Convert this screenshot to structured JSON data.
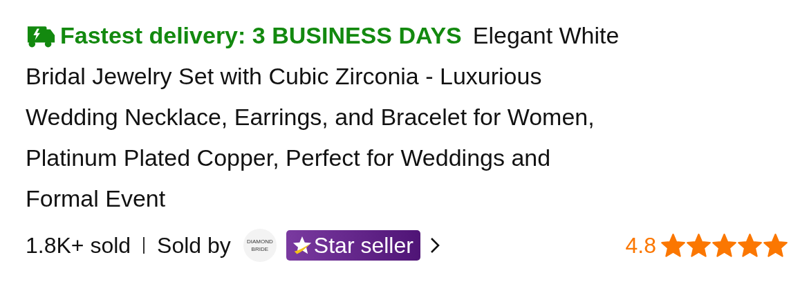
{
  "delivery": {
    "label": "Fastest delivery: 3 BUSINESS DAYS"
  },
  "title_lines": [
    "Elegant White",
    "Bridal Jewelry Set with Cubic Zirconia - Luxurious",
    "Wedding Necklace, Earrings, and Bracelet for Women,",
    "Platinum Plated Copper, Perfect for Weddings and",
    "Formal Event"
  ],
  "sold": "1.8K+ sold",
  "sold_by": "Sold by",
  "seller_logo": [
    "DIAMOND",
    "BRIDE"
  ],
  "badge": "Star seller",
  "rating": "4.8",
  "stars": 5
}
